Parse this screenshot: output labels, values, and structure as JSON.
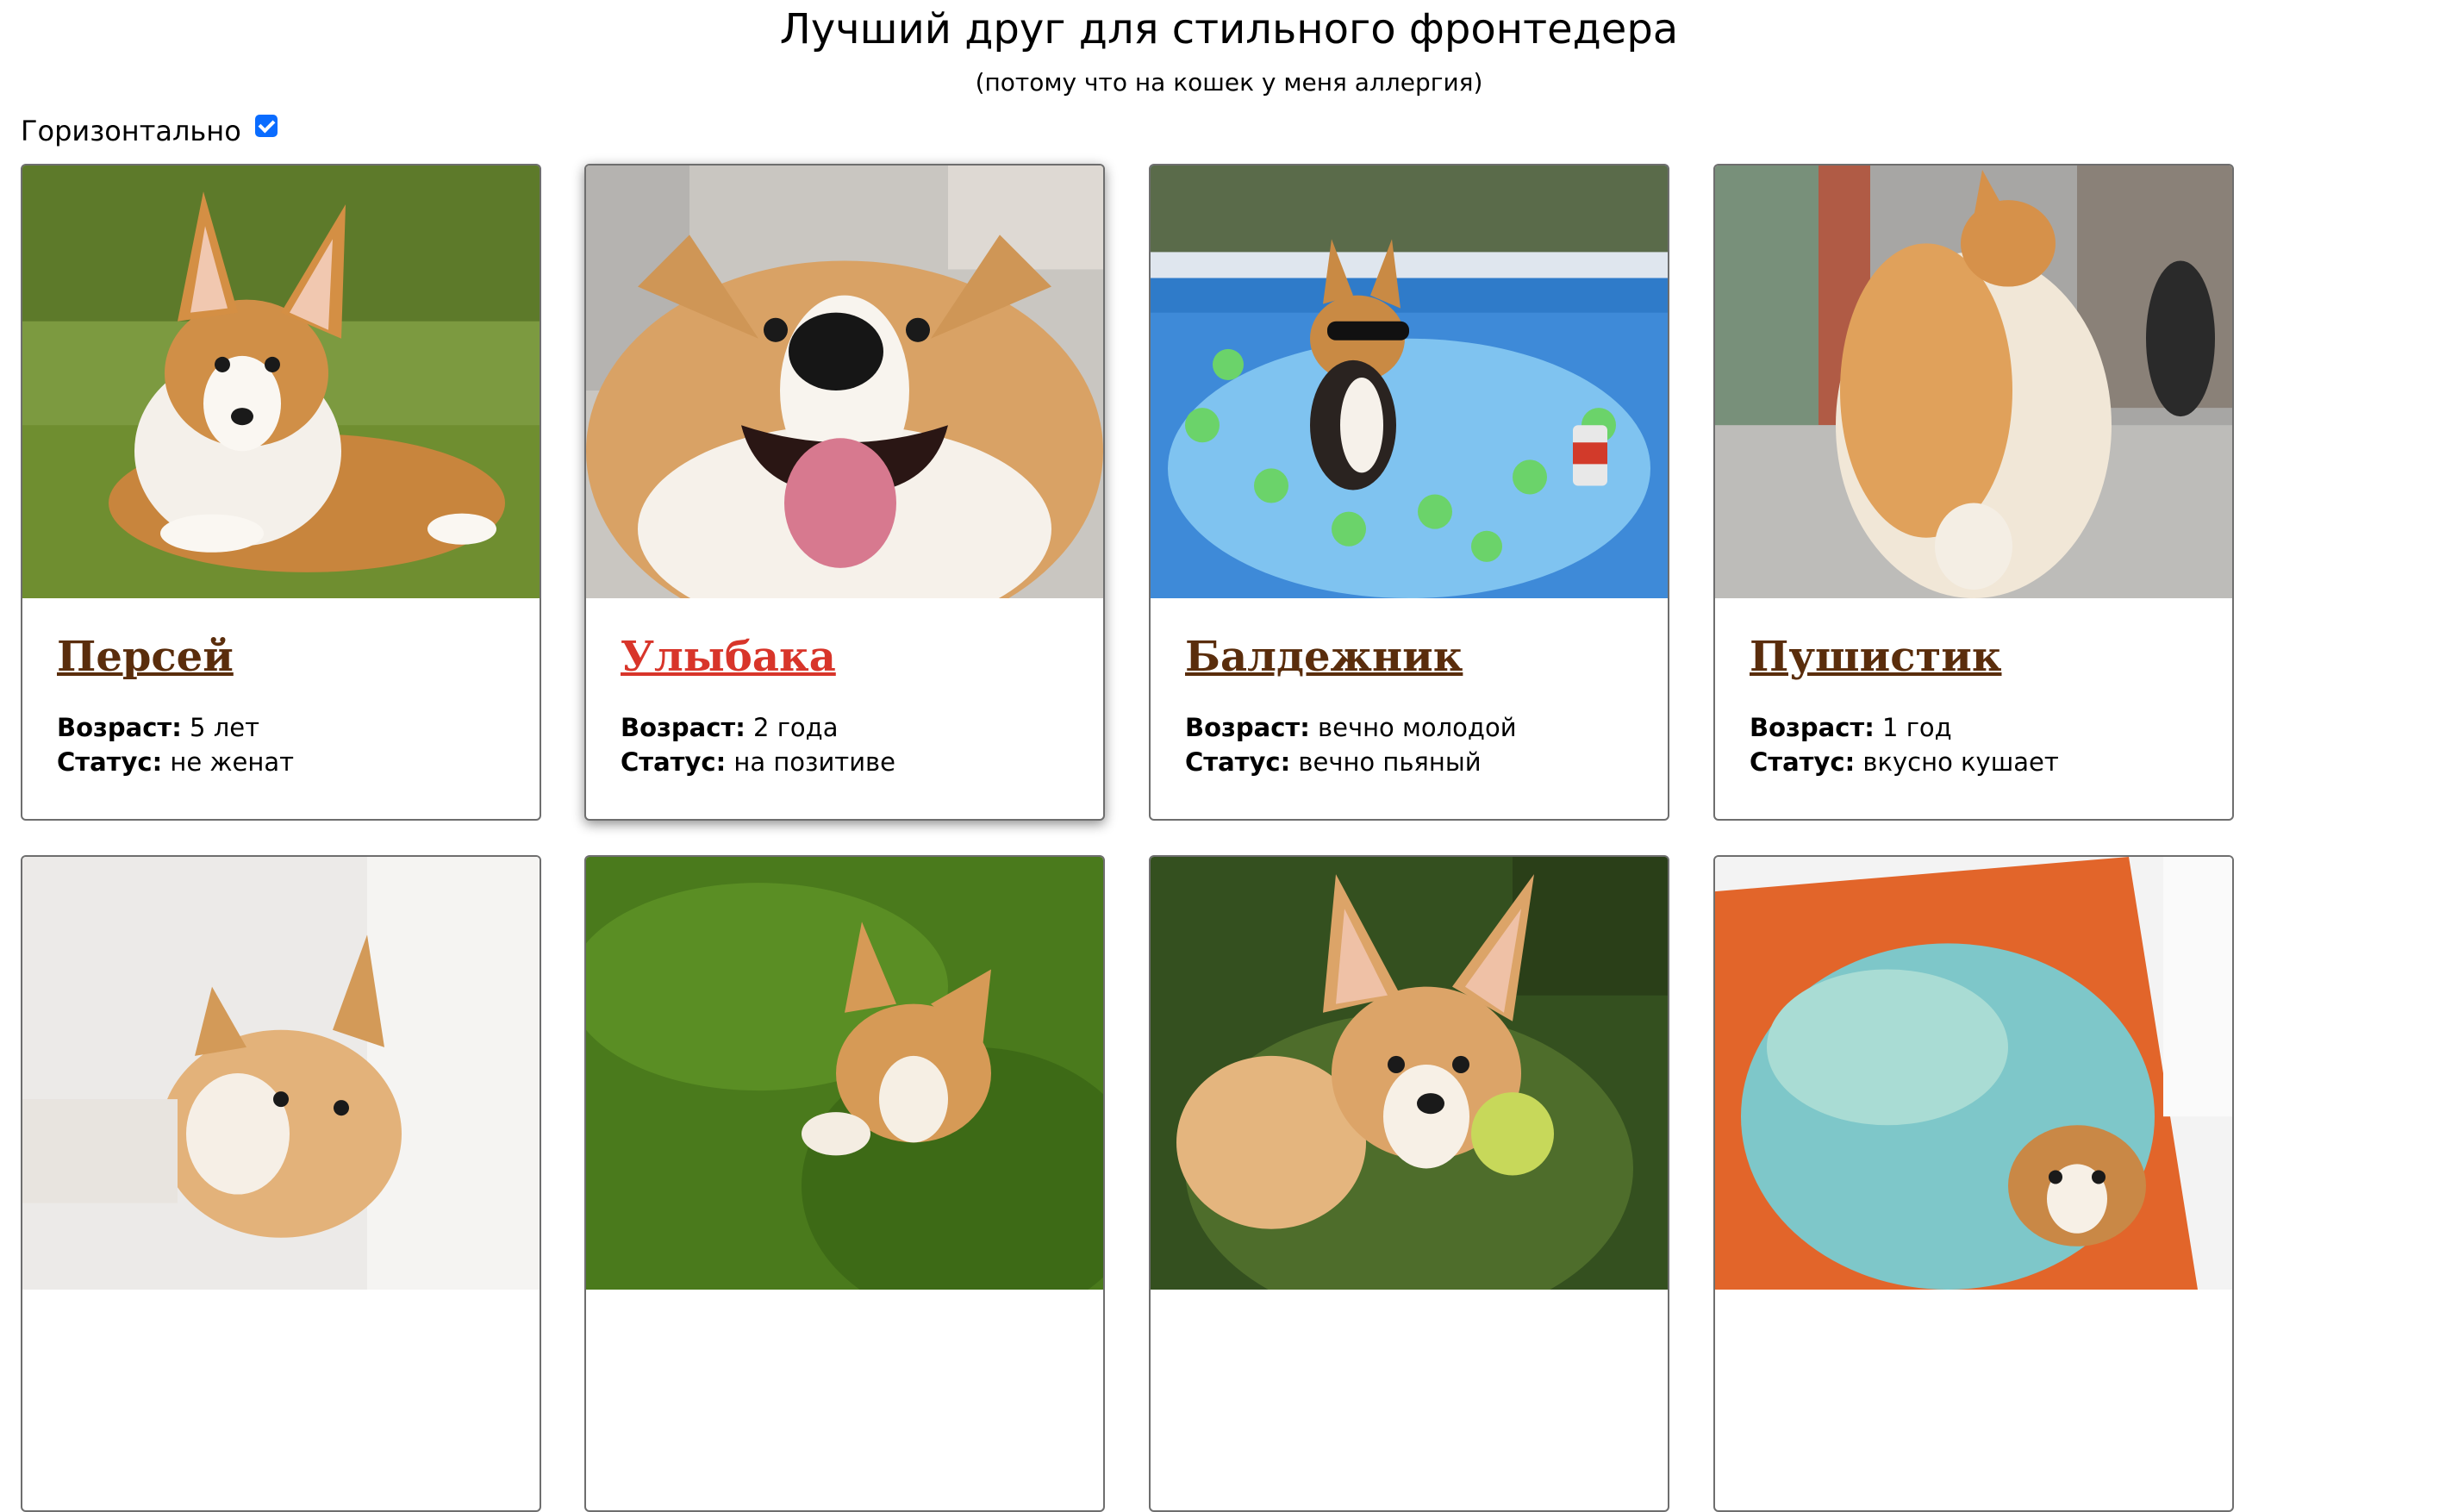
{
  "page": {
    "title": "Лучший друг для стильного фронтедера",
    "subtitle": "(потому что на кошек у меня аллергия)"
  },
  "toggle": {
    "label": "Горизонтально",
    "checked": true
  },
  "labels": {
    "age": "Возраст:",
    "status": "Статус:"
  },
  "dogs": [
    {
      "name": "Персей",
      "age": "5 лет",
      "status": "не женат",
      "active": false
    },
    {
      "name": "Улыбака",
      "age": "2 года",
      "status": "на позитиве",
      "active": true
    },
    {
      "name": "Балдежник",
      "age": "вечно молодой",
      "status": "вечно пьяный",
      "active": false
    },
    {
      "name": "Пушистик",
      "age": "1 год",
      "status": "вкусно кушает",
      "active": false
    },
    {
      "name": "",
      "age": "",
      "status": "",
      "active": false
    },
    {
      "name": "",
      "age": "",
      "status": "",
      "active": false
    },
    {
      "name": "",
      "age": "",
      "status": "",
      "active": false
    },
    {
      "name": "",
      "age": "",
      "status": "",
      "active": false
    }
  ],
  "colors": {
    "name": "#5a2d0c",
    "name_active": "#d8352a",
    "checkbox": "#0a6cff"
  }
}
